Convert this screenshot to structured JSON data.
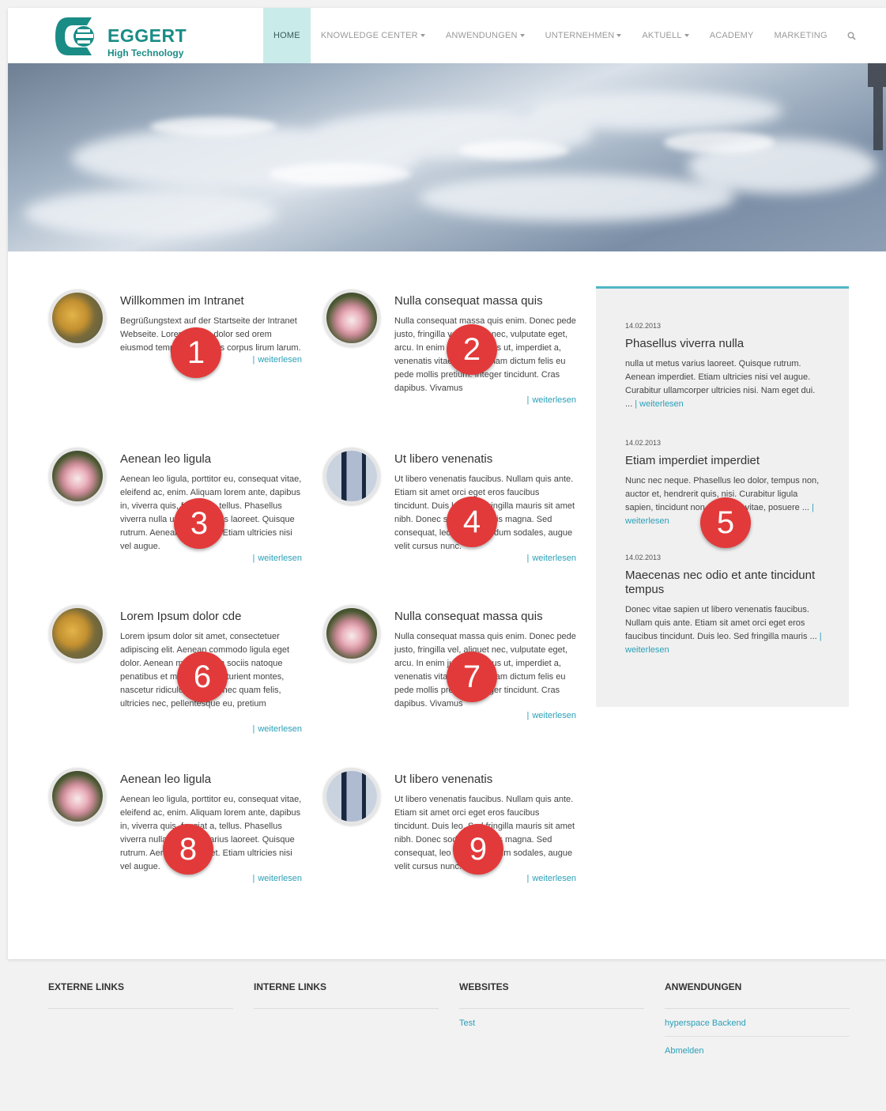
{
  "brand": {
    "name": "EGGERT",
    "tagline": "High Technology",
    "color": "#1a8c86"
  },
  "nav": {
    "items": [
      {
        "label": "HOME",
        "active": true,
        "dropdown": false
      },
      {
        "label": "KNOWLEDGE CENTER",
        "active": false,
        "dropdown": true
      },
      {
        "label": "ANWENDUNGEN",
        "active": false,
        "dropdown": true
      },
      {
        "label": "UNTERNEHMEN",
        "active": false,
        "dropdown": true
      },
      {
        "label": "AKTUELL",
        "active": false,
        "dropdown": true
      },
      {
        "label": "ACADEMY",
        "active": false,
        "dropdown": false
      },
      {
        "label": "MARKETING",
        "active": false,
        "dropdown": false
      }
    ],
    "search_icon": "search-icon"
  },
  "articles": [
    {
      "title": "Willkommen im Intranet",
      "text": "Begrüßungstext auf der Startseite der Intranet Webseite. Lorem ipsum dolor sed orem eiusmod tempor sit habeas corpus lirum larum.",
      "more": "weiterlesen",
      "thumb": "coin",
      "badge": "1"
    },
    {
      "title": "Nulla consequat massa quis",
      "text": "Nulla consequat massa quis enim. Donec pede justo, fringilla vel, aliquet nec, vulputate eget, arcu. In enim justo, rhoncus ut, imperdiet a, venenatis vitae, justo. Nullam dictum felis eu pede mollis pretium. Integer tincidunt. Cras dapibus. Vivamus",
      "more": "weiterlesen",
      "thumb": "flower",
      "badge": "2"
    },
    {
      "title": "Aenean leo ligula",
      "text": "Aenean leo ligula, porttitor eu, consequat vitae, eleifend ac, enim. Aliquam lorem ante, dapibus in, viverra quis, feugiat a, tellus. Phasellus viverra nulla ut metus varius laoreet. Quisque rutrum. Aenean imperdiet. Etiam ultricies nisi vel augue.",
      "more": "weiterlesen",
      "thumb": "flower",
      "badge": "3"
    },
    {
      "title": "Ut libero venenatis",
      "text": "Ut libero venenatis faucibus. Nullam quis ante. Etiam sit amet orci eget eros faucibus tincidunt. Duis leo. Sed fringilla mauris sit amet nibh. Donec sodales sagittis magna. Sed consequat, leo eget bibendum sodales, augue velit cursus nunc.",
      "more": "weiterlesen",
      "thumb": "window",
      "badge": "4"
    },
    {
      "title": "Lorem Ipsum dolor cde",
      "text": "Lorem ipsum dolor sit amet, consectetuer adipiscing elit. Aenean commodo ligula eget dolor. Aenean massa. Cum sociis natoque penatibus et magnis dis parturient montes, nascetur ridiculus mus. Donec quam felis, ultricies nec, pellentesque eu, pretium",
      "more": "weiterlesen",
      "thumb": "coin",
      "badge": "6"
    },
    {
      "title": "Nulla consequat massa quis",
      "text": "Nulla consequat massa quis enim. Donec pede justo, fringilla vel, aliquet nec, vulputate eget, arcu. In enim justo, rhoncus ut, imperdiet a, venenatis vitae, justo. Nullam dictum felis eu pede mollis pretium. Integer tincidunt. Cras dapibus. Vivamus",
      "more": "weiterlesen",
      "thumb": "flower",
      "badge": "7"
    },
    {
      "title": "Aenean leo ligula",
      "text": "Aenean leo ligula, porttitor eu, consequat vitae, eleifend ac, enim. Aliquam lorem ante, dapibus in, viverra quis, feugiat a, tellus. Phasellus viverra nulla ut metus varius laoreet. Quisque rutrum. Aenean imperdiet. Etiam ultricies nisi vel augue.",
      "more": "weiterlesen",
      "thumb": "flower",
      "badge": "8"
    },
    {
      "title": "Ut libero venenatis",
      "text": "Ut libero venenatis faucibus. Nullam quis ante. Etiam sit amet orci eget eros faucibus tincidunt. Duis leo. Sed fringilla mauris sit amet nibh. Donec sodales sagittis magna. Sed consequat, leo eget bibendum sodales, augue velit cursus nunc.",
      "more": "weiterlesen",
      "thumb": "window",
      "badge": "9"
    }
  ],
  "sidebar": {
    "badge": "5",
    "news": [
      {
        "date": "14.02.2013",
        "title": "Phasellus viverra nulla",
        "text": "nulla ut metus varius laoreet. Quisque rutrum. Aenean imperdiet. Etiam ultricies nisi vel augue. Curabitur ullamcorper ultricies nisi. Nam eget dui. ...",
        "more": "weiterlesen"
      },
      {
        "date": "14.02.2013",
        "title": "Etiam imperdiet imperdiet",
        "text": "Nunc nec neque. Phasellus leo dolor, tempus non, auctor et, hendrerit quis, nisi. Curabitur ligula sapien, tincidunt non, euismod vitae, posuere ...",
        "more": "weiterlesen"
      },
      {
        "date": "14.02.2013",
        "title": "Maecenas nec odio et ante tincidunt tempus",
        "text": "Donec vitae sapien ut libero venenatis faucibus. Nullam quis ante. Etiam sit amet orci eget eros faucibus tincidunt. Duis leo. Sed fringilla mauris ...",
        "more": "weiterlesen"
      }
    ]
  },
  "footer": {
    "columns": [
      {
        "heading": "EXTERNE LINKS",
        "links": []
      },
      {
        "heading": "INTERNE LINKS",
        "links": []
      },
      {
        "heading": "WEBSITES",
        "links": [
          "Test"
        ]
      },
      {
        "heading": "ANWENDUNGEN",
        "links": [
          "hyperspace Backend",
          "Abmelden"
        ]
      }
    ]
  },
  "colors": {
    "accent": "#2aa0b8",
    "nav_active_bg": "#c9ebea",
    "badge": "#e23a3a",
    "sidebar_border": "#4fb6c4"
  }
}
